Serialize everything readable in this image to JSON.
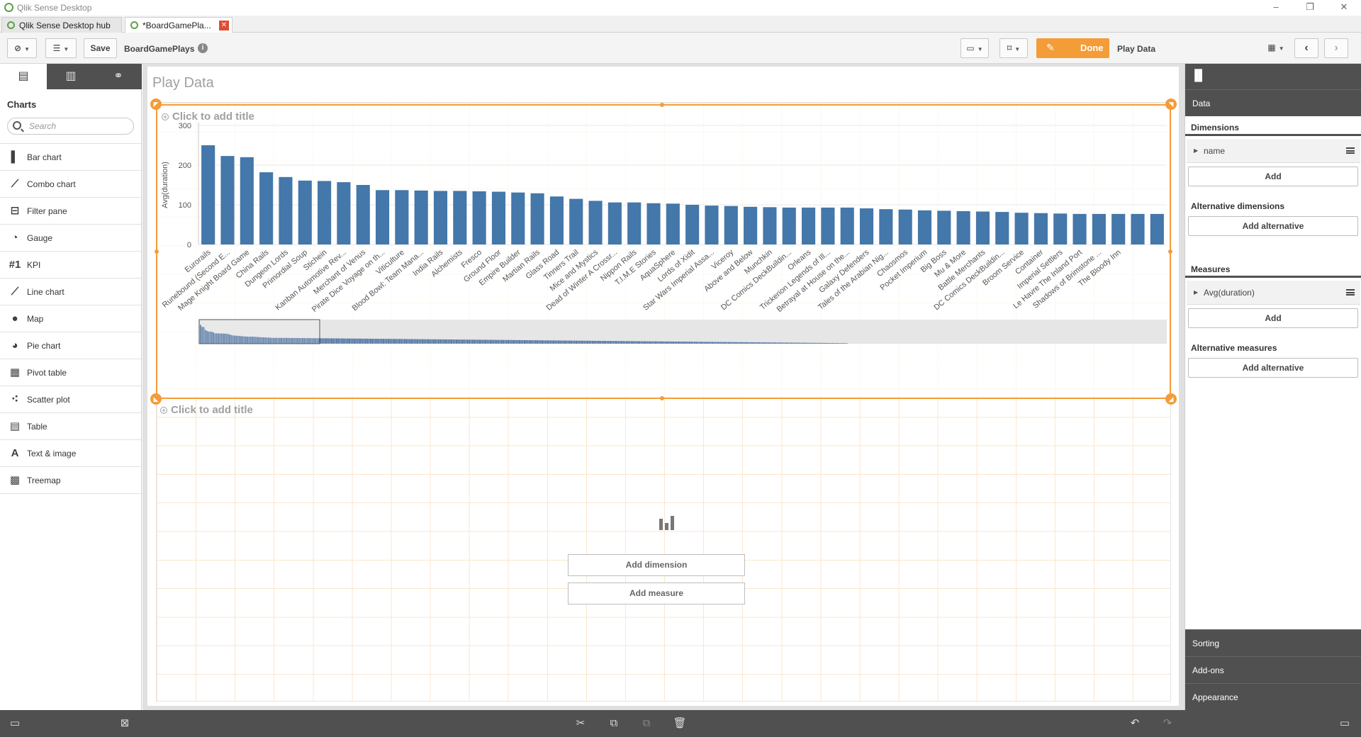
{
  "window": {
    "title": "Qlik Sense Desktop",
    "minimize": "–",
    "restore": "❐",
    "close": "✕"
  },
  "tabs": [
    {
      "label": "Qlik Sense Desktop hub"
    },
    {
      "label": "*BoardGamePla...",
      "close": "✕"
    }
  ],
  "toolbar": {
    "save_label": "Save",
    "app_name": "BoardGamePlays",
    "info": "i",
    "done_label": "Done",
    "sheet_name": "Play Data"
  },
  "left_panel": {
    "heading": "Charts",
    "search_placeholder": "Search",
    "items": [
      {
        "label": "Bar chart",
        "icon": "bar-chart-icon"
      },
      {
        "label": "Combo chart",
        "icon": "combo-chart-icon"
      },
      {
        "label": "Filter pane",
        "icon": "filter-pane-icon"
      },
      {
        "label": "Gauge",
        "icon": "gauge-icon"
      },
      {
        "label": "KPI",
        "icon": "kpi-icon"
      },
      {
        "label": "Line chart",
        "icon": "line-chart-icon"
      },
      {
        "label": "Map",
        "icon": "map-icon"
      },
      {
        "label": "Pie chart",
        "icon": "pie-chart-icon"
      },
      {
        "label": "Pivot table",
        "icon": "pivot-table-icon"
      },
      {
        "label": "Scatter plot",
        "icon": "scatter-plot-icon"
      },
      {
        "label": "Table",
        "icon": "table-icon"
      },
      {
        "label": "Text & image",
        "icon": "text-image-icon"
      },
      {
        "label": "Treemap",
        "icon": "treemap-icon"
      }
    ]
  },
  "sheet": {
    "title": "Play Data",
    "viz1_title_placeholder": "Click to add title",
    "viz2_title_placeholder": "Click to add title",
    "add_dimension": "Add dimension",
    "add_measure": "Add measure"
  },
  "chart_data": {
    "type": "bar",
    "title": "",
    "xlabel": "name",
    "ylabel": "Avg(duration)",
    "ylim": [
      0,
      300
    ],
    "yticks": [
      0,
      100,
      200,
      300
    ],
    "grid": true,
    "color": "#4477aa",
    "categories": [
      "Eurorails",
      "Runebound (Second E...",
      "Mage Knight Board Game",
      "China Rails",
      "Dungeon Lords",
      "Primordial Soup",
      "Stichein",
      "Kanban Automotive Rev...",
      "Merchant of Venus",
      "Pirate Dice Voyage on th...",
      "Viticulture",
      "Blood Bowl: Team Mana...",
      "India Rails",
      "Alchemists",
      "Fresco",
      "Ground Floor",
      "Empire Builder",
      "Martian Rails",
      "Glass Road",
      "Tinners Trail",
      "Mice and Mystics",
      "Dead of Winter A Crossr...",
      "Nippon Rails",
      "T.I.M.E Stories",
      "AquaSphere",
      "Lords of Xidit",
      "Star Wars Imperial Assa...",
      "Viceroy",
      "Above and Below",
      "Munchkin",
      "DC Comics DeckBuildin...",
      "Orleans",
      "Trickerion Legends of Ill...",
      "Betrayal at House on the...",
      "Galaxy Defenders",
      "Tales of the Arabian Nig...",
      "Chaosmos",
      "Pocket Imperium",
      "Big Boss",
      "Mu & More",
      "Battle Merchants",
      "DC Comics DeckBuildin...",
      "Broom Service",
      "Container",
      "Imperial Settlers",
      "Le Havre The Inland Port",
      "Shadows of Brimstone ...",
      "The Bloody Inn"
    ],
    "values": [
      250,
      223,
      220,
      182,
      170,
      161,
      160,
      157,
      150,
      137,
      137,
      136,
      135,
      135,
      134,
      133,
      131,
      129,
      121,
      115,
      110,
      106,
      106,
      104,
      103,
      100,
      98,
      97,
      95,
      94,
      93,
      93,
      93,
      93,
      91,
      89,
      88,
      86,
      85,
      84,
      83,
      82,
      80,
      79,
      78,
      77,
      77,
      77,
      77,
      77
    ]
  },
  "right_panel": {
    "data_tab": "Data",
    "dimensions_heading": "Dimensions",
    "dimension_item": "name",
    "add_label": "Add",
    "alt_dimensions_heading": "Alternative dimensions",
    "add_alternative": "Add alternative",
    "measures_heading": "Measures",
    "measure_item": "Avg(duration)",
    "alt_measures_heading": "Alternative measures",
    "sorting": "Sorting",
    "addons": "Add-ons",
    "appearance": "Appearance"
  }
}
